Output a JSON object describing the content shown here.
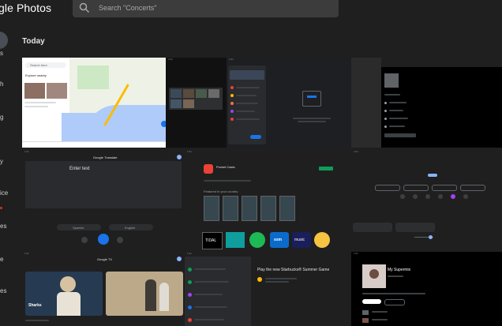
{
  "app": {
    "title_fragment": "gle Photos",
    "title_first": "g"
  },
  "search": {
    "placeholder": "Search \"Concerts\""
  },
  "rail": {
    "fragments": [
      "s",
      "h",
      "g",
      "y",
      "ice",
      "es",
      "e",
      "es"
    ]
  },
  "section": {
    "title": "Today"
  },
  "tiles": {
    "maps": {
      "search": "Search here",
      "explore": "Explore nearby"
    },
    "translate": {
      "title": "Google Translate",
      "placeholder": "Enter text",
      "lang_from": "Spanish",
      "lang_to": "English"
    },
    "store": {
      "app_name": "Pocket Casts",
      "section": "Featured in your country",
      "tidal": "TIDAL",
      "sxm": "sxm",
      "music": "music"
    },
    "tv": {
      "title": "Google TV",
      "movie_label": "Sharks"
    },
    "chat": {
      "header": "Play the new Starbucks® Summer Game"
    },
    "music": {
      "playlist": "My Supermix"
    },
    "status_time": "1:01"
  },
  "colors": {
    "background": "#1f1f1f",
    "search_bg": "#3c3c3c",
    "tile_bg": "#202124",
    "accent_blue": "#1a73e8",
    "teal": "#0f9d58",
    "spotify": "#1db954",
    "sxm": "#0b6bcb",
    "amazon_music": "#1a1e5a",
    "pocket_red": "#ea4335"
  },
  "icons": [
    "search-icon"
  ]
}
